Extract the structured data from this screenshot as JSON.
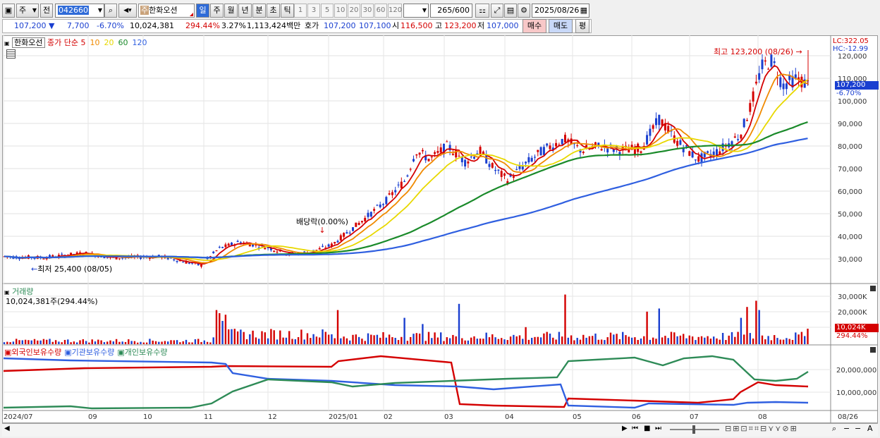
{
  "toolbar": {
    "market_type": "주",
    "prev_label": "전",
    "stock_code": "042660",
    "stock_name": "한화오션",
    "stock_badge": "주",
    "periods_main": [
      "일",
      "주",
      "월",
      "년",
      "분",
      "초",
      "틱"
    ],
    "periods_num": [
      "1",
      "3",
      "5",
      "10",
      "20",
      "30",
      "60",
      "120"
    ],
    "count_value": "265",
    "count_max": "/600",
    "date_value": "2025/08/26"
  },
  "quote": {
    "price": "107,200",
    "change": "7,700",
    "change_rate": "-6.70%",
    "volume": "10,024,381",
    "volume_rate": "294.44%",
    "turnover_rate": "3.27%",
    "amount": "1,113,424백만",
    "hoga_label": "호가",
    "ask": "107,200",
    "bid": "107,100",
    "open_label": "시",
    "open": "116,500",
    "high_label": "고",
    "high": "123,200",
    "low_label": "저",
    "low": "107,000",
    "buy_label": "매수",
    "sell_label": "매도",
    "eval_label": "평"
  },
  "price_panel": {
    "stock_tag": "한화오선",
    "legend_prefix": "종가 단순",
    "ma_labels": [
      "5",
      "10",
      "20",
      "60",
      "120"
    ],
    "ma_colors": [
      "#d40000",
      "#f08a00",
      "#e8d800",
      "#1a8a2a",
      "#2f5fe0"
    ],
    "y_ticks": [
      "120,000",
      "110,000",
      "100,000",
      "90,000",
      "80,000",
      "70,000",
      "60,000",
      "50,000",
      "40,000",
      "30,000"
    ],
    "lc_label": "LC:322.05",
    "hc_label": "HC:-12.99",
    "current_price_tag": "107,200",
    "current_rate_tag": "-6.70%",
    "high_annotation": "최고 123,200 (08/26)",
    "low_annotation": "최저 25,400 (08/05)",
    "dividend_annotation": "배당락(0.00%)"
  },
  "volume_panel": {
    "title": "거래량",
    "value_text": "10,024,381주(294.44%)",
    "y_ticks": [
      "30,000K",
      "20,000K",
      "10,000K"
    ],
    "current_tag": "10,024K",
    "current_rate": "294.44%"
  },
  "holding_panel": {
    "legend": [
      "외국인보유수량",
      "기관보유수량",
      "개인보유수량"
    ],
    "colors": [
      "#d40000",
      "#2f5fe0",
      "#2e8b57"
    ],
    "y_ticks": [
      "20,000,000",
      "10,000,000"
    ]
  },
  "x_axis": {
    "labels": [
      "2024/07",
      "09",
      "10",
      "11",
      "12",
      "2025/01",
      "02",
      "03",
      "04",
      "05",
      "06",
      "07",
      "08"
    ],
    "right_label": "08/26"
  }
}
